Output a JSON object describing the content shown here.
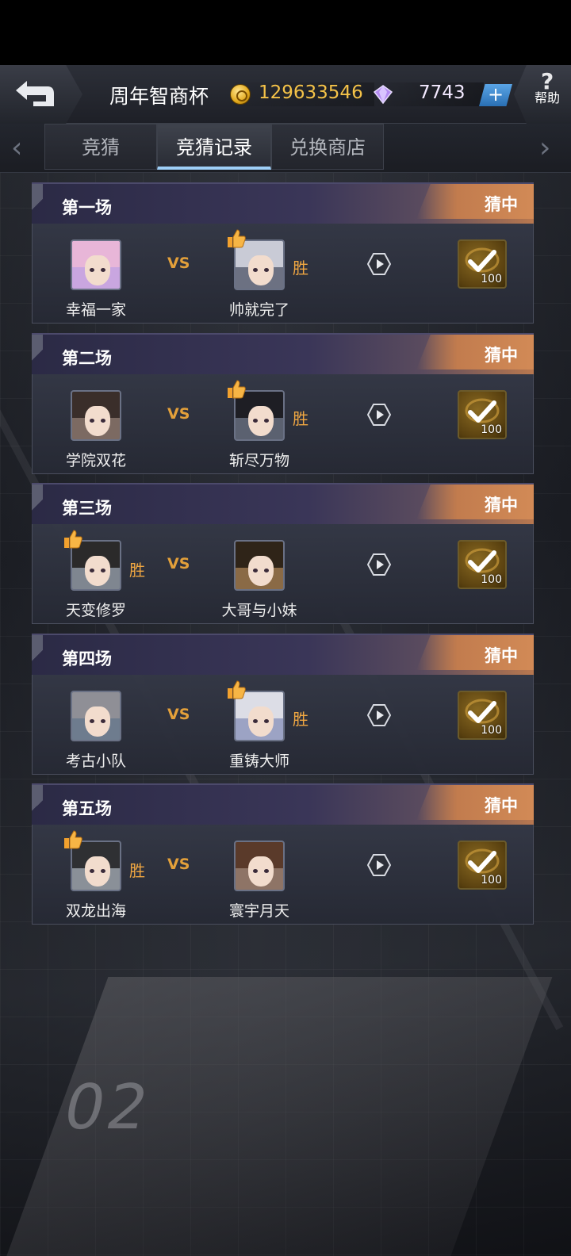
{
  "header": {
    "title": "周年智商杯",
    "coins": "129633546",
    "gems": "7743",
    "add_label": "+",
    "help_label": "帮助"
  },
  "tabs": [
    {
      "label": "竞猜",
      "active": false
    },
    {
      "label": "竞猜记录",
      "active": true
    },
    {
      "label": "兑换商店",
      "active": false
    }
  ],
  "matches": [
    {
      "title": "第一场",
      "result": "猜中",
      "left_name": "幸福一家",
      "right_name": "帅就完了",
      "winner": "right",
      "vs": "VS",
      "win_label": "胜",
      "reward": "100"
    },
    {
      "title": "第二场",
      "result": "猜中",
      "left_name": "学院双花",
      "right_name": "斩尽万物",
      "winner": "right",
      "vs": "VS",
      "win_label": "胜",
      "reward": "100"
    },
    {
      "title": "第三场",
      "result": "猜中",
      "left_name": "天变修罗",
      "right_name": "大哥与小妹",
      "winner": "left",
      "vs": "VS",
      "win_label": "胜",
      "reward": "100"
    },
    {
      "title": "第四场",
      "result": "猜中",
      "left_name": "考古小队",
      "right_name": "重铸大师",
      "winner": "right",
      "vs": "VS",
      "win_label": "胜",
      "reward": "100"
    },
    {
      "title": "第五场",
      "result": "猜中",
      "left_name": "双龙出海",
      "right_name": "寰宇月天",
      "winner": "left",
      "vs": "VS",
      "win_label": "胜",
      "reward": "100"
    }
  ],
  "background_mark": "02",
  "colors": {
    "accent": "#f4c248",
    "win": "#f0a742",
    "hit_badge": "#c27c4e",
    "tab_active": "#9ecff7"
  }
}
